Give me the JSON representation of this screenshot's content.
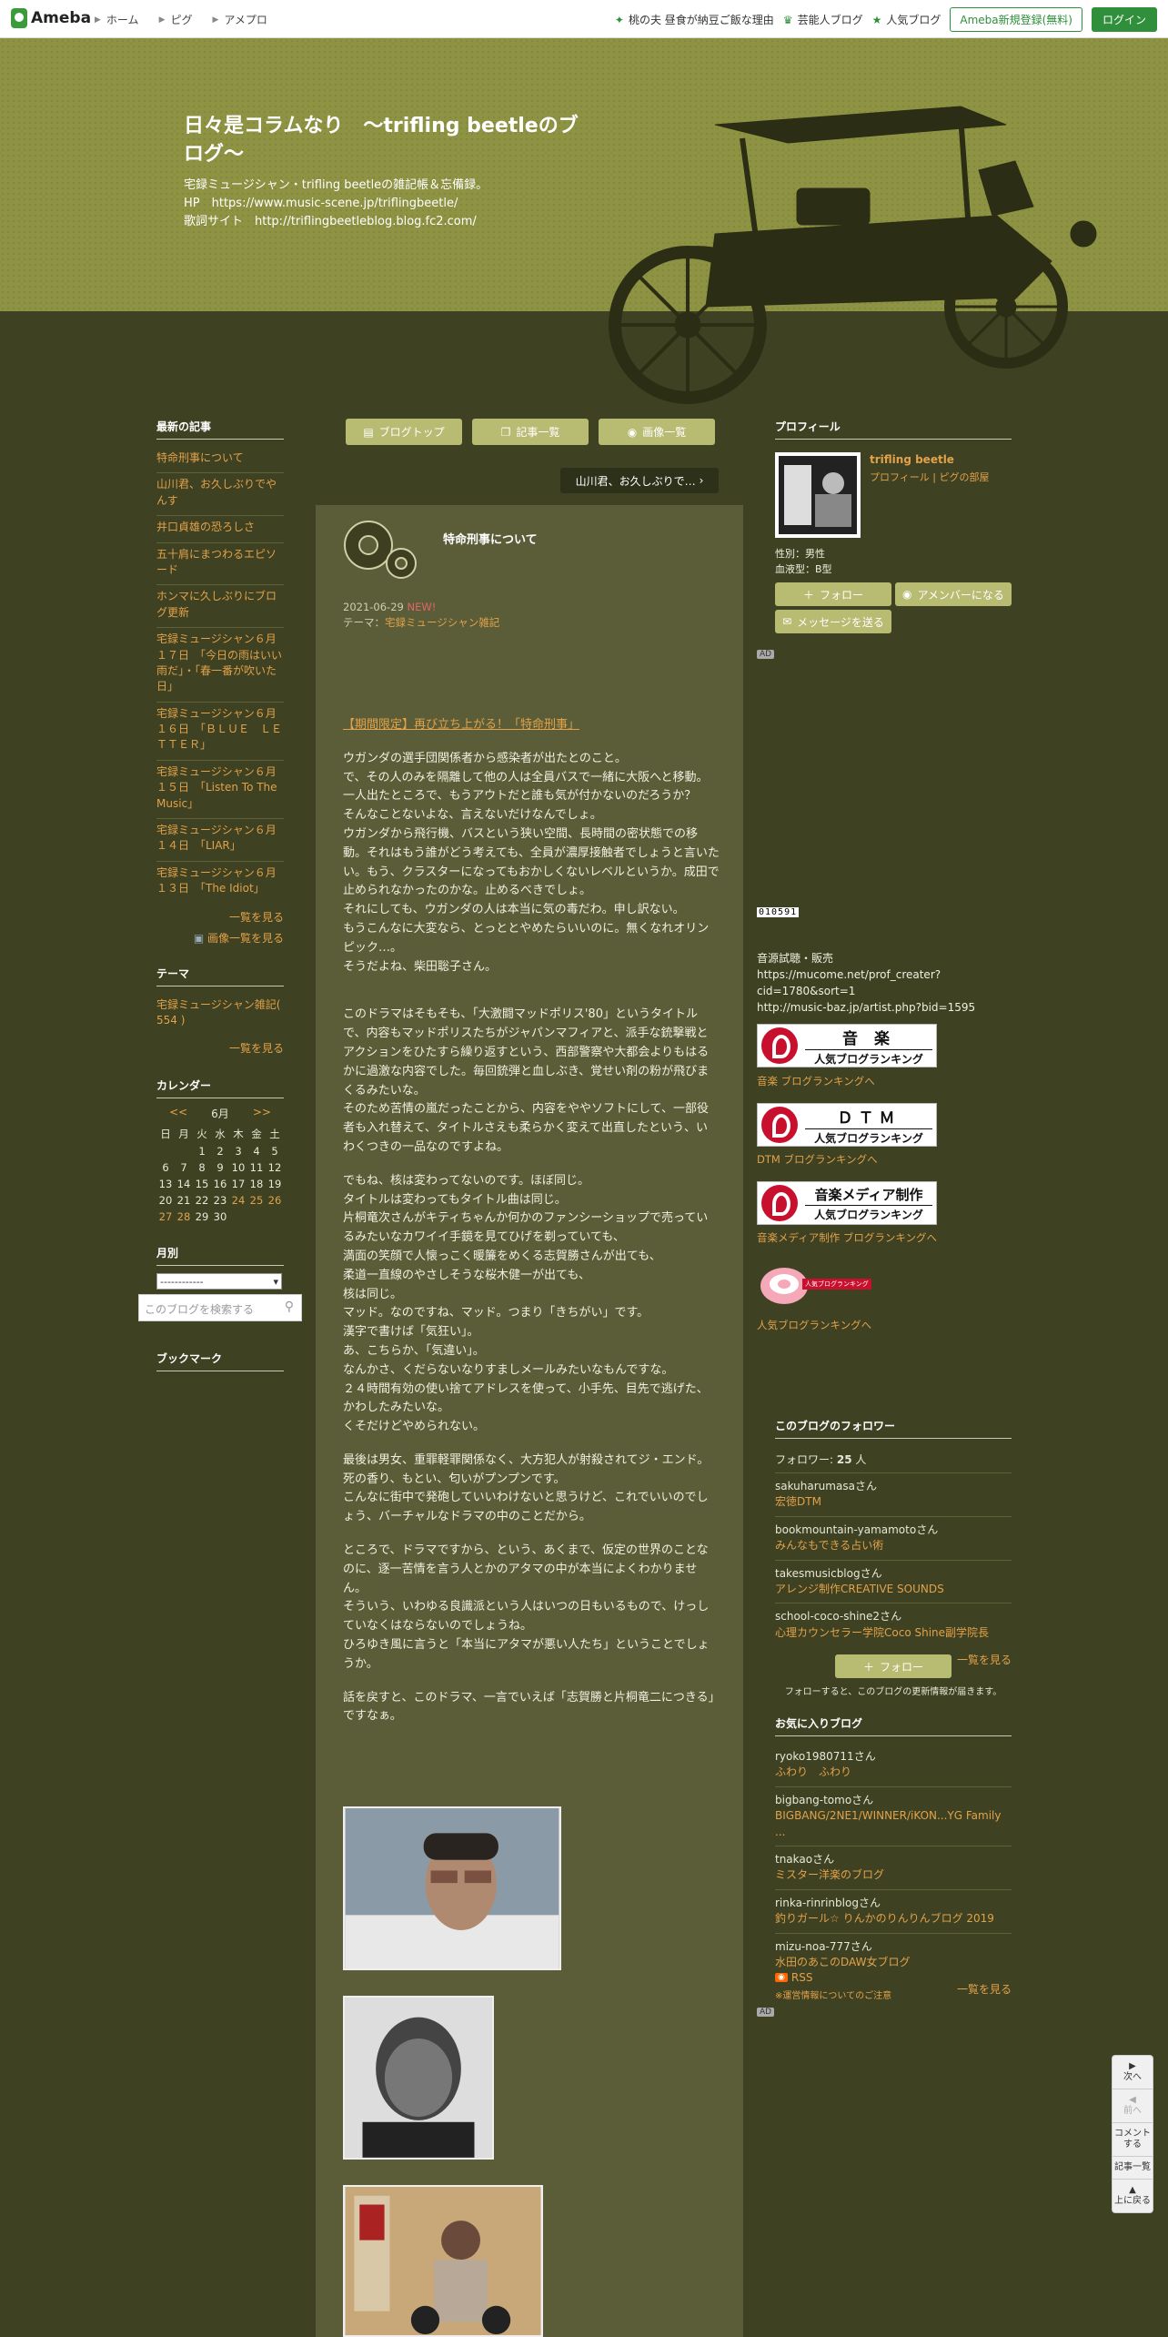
{
  "topbar": {
    "logo": "Ameba",
    "nav": [
      "ホーム",
      "ピグ",
      "アメプロ"
    ],
    "right_links": [
      "桃の夫 昼食が納豆ご飯な理由",
      "芸能人ブログ",
      "人気ブログ"
    ],
    "register_label": "Ameba新規登録(無料)",
    "login_label": "ログイン"
  },
  "header": {
    "title": "日々是コラムなり　～trifling beetleのブログ～",
    "description": "宅録ミュージシャン・trifling beetleの雑記帳＆忘備録。\nHP　https://www.music-scene.jp/triflingbeetle/\n歌詞サイト　http://triflingbeetleblog.blog.fc2.com/"
  },
  "left": {
    "recent_title": "最新の記事",
    "recent": [
      "特命刑事について",
      "山川君、お久しぶりでやんす",
      "井口貞雄の恐ろしさ",
      "五十肩にまつわるエピソード",
      "ホンマに久しぶりにブログ更新",
      "宅録ミュージシャン６月１７日　「今日の雨はいい雨だ」・「春一番が吹いた日」",
      "宅録ミュージシャン６月１６日　「ＢＬＵＥ　ＬＥＴＴＥＲ」",
      "宅録ミュージシャン６月１５日　「Listen To The Music」",
      "宅録ミュージシャン６月１４日　「LIAR」",
      "宅録ミュージシャン６月１３日　「The Idiot」"
    ],
    "more": "一覧を見る",
    "image_more": "画像一覧を見る",
    "theme_title": "テーマ",
    "theme_item": "宅録ミュージシャン雑記( 554 )",
    "calendar_title": "カレンダー",
    "cal_prev": "<<",
    "cal_month": "6月",
    "cal_next": ">>",
    "weekdays": [
      "日",
      "月",
      "火",
      "水",
      "木",
      "金",
      "土"
    ],
    "weeks": [
      [
        "",
        "",
        "1",
        "2",
        "3",
        "4",
        "5"
      ],
      [
        "6",
        "7",
        "8",
        "9",
        "10",
        "11",
        "12"
      ],
      [
        "13",
        "14",
        "15",
        "16",
        "17",
        "18",
        "19"
      ],
      [
        "20",
        "21",
        "22",
        "23",
        "24",
        "25",
        "26"
      ],
      [
        "27",
        "28",
        "29",
        "30",
        "",
        "",
        ""
      ]
    ],
    "monthly_title": "月別",
    "monthly_value": "------------",
    "search_placeholder": "このブログを検索する",
    "bookmark_title": "ブックマーク"
  },
  "main": {
    "tabs": [
      "ブログトップ",
      "記事一覧",
      "画像一覧"
    ],
    "prev_article": "山川君、お久しぶりで…",
    "title": "特命刑事について",
    "date": "2021-06-29",
    "tag": "NEW!",
    "theme_label": "テーマ：",
    "theme": "宅録ミュージシャン雑記",
    "link": "【期間限定】再び立ち上がる！「特命刑事」",
    "paragraphs": [
      "ウガンダの選手団関係者から感染者が出たとのこと。\nで、その人のみを隔離して他の人は全員バスで一緒に大阪へと移動。\n一人出たところで、もうアウトだと誰も気が付かないのだろうか？\nそんなことないよな、言えないだけなんでしょ。\nウガンダから飛行機、バスという狭い空間、長時間の密状態での移動。それはもう誰がどう考えても、全員が濃厚接触者でしょうと言いたい。もう、クラスターになってもおかしくないレベルというか。成田で止められなかったのかな。止めるべきでしょ。\nそれにしても、ウガンダの人は本当に気の毒だわ。申し訳ない。\nもうこんなに大変なら、とっととやめたらいいのに。無くなれオリンピック…。\nそうだよね、柴田聡子さん。",
      "このドラマはそもそも、「大激闘マッドポリス'80」というタイトルで、内容もマッドポリスたちがジャパンマフィアと、派手な銃撃戦とアクションをひたすら繰り返すという、西部警察や大都会よりもはるかに過激な内容でした。毎回銃弾と血しぶき、覚せい剤の粉が飛びまくるみたいな。\nそのため苦情の嵐だったことから、内容をややソフトにして、一部役者も入れ替えて、タイトルさえも柔らかく変えて出直したという、いわくつきの一品なのですよね。",
      "でもね、核は変わってないのです。ほぼ同じ。\nタイトルは変わってもタイトル曲は同じ。\n片桐竜次さんがキティちゃんか何かのファンシーショップで売っているみたいなカワイイ手鏡を見てひげを剃っていても、\n満面の笑顔で人懐っこく暖簾をめくる志賀勝さんが出ても、\n柔道一直線のやさしそうな桜木健一が出ても、\n核は同じ。\nマッド。なのですね、マッド。つまり「きちがい」です。\n漢字で書けば「気狂い」。\nあ、こちらか、「気違い」。\nなんかさ、くだらないなりすましメールみたいなもんですな。\n２４時間有効の使い捨てアドレスを使って、小手先、目先で逃げた、かわしたみたいな。\nくそだけどやめられない。",
      "最後は男女、重罪軽罪関係なく、大方犯人が射殺されてジ・エンド。死の香り、もとい、匂いがプンプンです。\nこんなに街中で発砲していいわけないと思うけど、これでいいのでしょう、バーチャルなドラマの中のことだから。",
      "ところで、ドラマですから、という、あくまで、仮定の世界のことなのに、逐一苦情を言う人とかのアタマの中が本当によくわかりません。\nそういう、いわゆる良識派という人はいつの日もいるもので、けっしていなくはならないのでしょうね。\nひろゆき風に言うと「本当にアタマが悪い人たち」ということでしょうか。",
      "話を戻すと、このドラマ、一言でいえば「志賀勝と片桐竜二につきる」ですなぁ。"
    ]
  },
  "right": {
    "profile_title": "プロフィール",
    "name": "trifling beetle",
    "profile_link1": "プロフィール",
    "profile_sep": "|",
    "profile_link2": "ピグの部屋",
    "gender": "性別：男性",
    "blood": "血液型：B型",
    "follow": "フォロー",
    "member": "アメンバーになる",
    "message": "メッセージを送る",
    "ad": "AD",
    "counter": "010591",
    "sales_text": "音源試聴・販売\nhttps://mucome.net/prof_creater?cid=1780&sort=1\nhttp://music-baz.jp/artist.php?bid=1595",
    "banners": [
      {
        "t1": "音 楽",
        "t2": "人気ブログランキング",
        "link": "音楽 ブログランキングへ"
      },
      {
        "t1": "ＤＴＭ",
        "t2": "人気ブログランキング",
        "link": "DTM ブログランキングへ"
      },
      {
        "t1": "音楽メディア制作",
        "t2": "人気ブログランキング",
        "link": "音楽メディア制作 ブログランキングへ"
      }
    ],
    "rank_link": "人気ブログランキングへ",
    "rank_badge": "人気ブログランキング",
    "followers_title": "このブログのフォロワー",
    "followers_label": "フォロワー:",
    "followers_count": "25",
    "followers_unit": "人",
    "followers": [
      {
        "user": "sakuharumasa",
        "blog": "宏徳DTM"
      },
      {
        "user": "bookmountain-yamamoto",
        "blog": "みんなもできる占い術"
      },
      {
        "user": "takesmusicblog",
        "blog": "アレンジ制作CREATIVE SOUNDS"
      },
      {
        "user": "school-coco-shine2",
        "blog": "心理カウンセラー学院Coco Shine副学院長"
      }
    ],
    "san": "さん",
    "more": "一覧を見る",
    "follow_btn": "フォロー",
    "follow_note": "フォローすると、このブログの更新情報が届きます。",
    "fav_title": "お気に入りブログ",
    "favorites": [
      {
        "user": "ryoko1980711",
        "blog": "ふわり　ふわり"
      },
      {
        "user": "bigbang-tomo",
        "blog": "BIGBANG/2NE1/WINNER/iKON...YG Family ..."
      },
      {
        "user": "tnakao",
        "blog": "ミスター洋楽のブログ"
      },
      {
        "user": "rinka-rinrinblog",
        "blog": "釣りガール☆ りんかのりんりんブログ 2019"
      },
      {
        "user": "mizu-noa-777",
        "blog": "水田のあこのDAW女ブログ"
      }
    ],
    "rss": "RSS",
    "rss_note": "※運営情報についてのご注意",
    "ad2": "AD"
  },
  "floatnav": [
    "次へ",
    "前へ",
    "コメントする",
    "記事一覧",
    "上に戻る"
  ]
}
